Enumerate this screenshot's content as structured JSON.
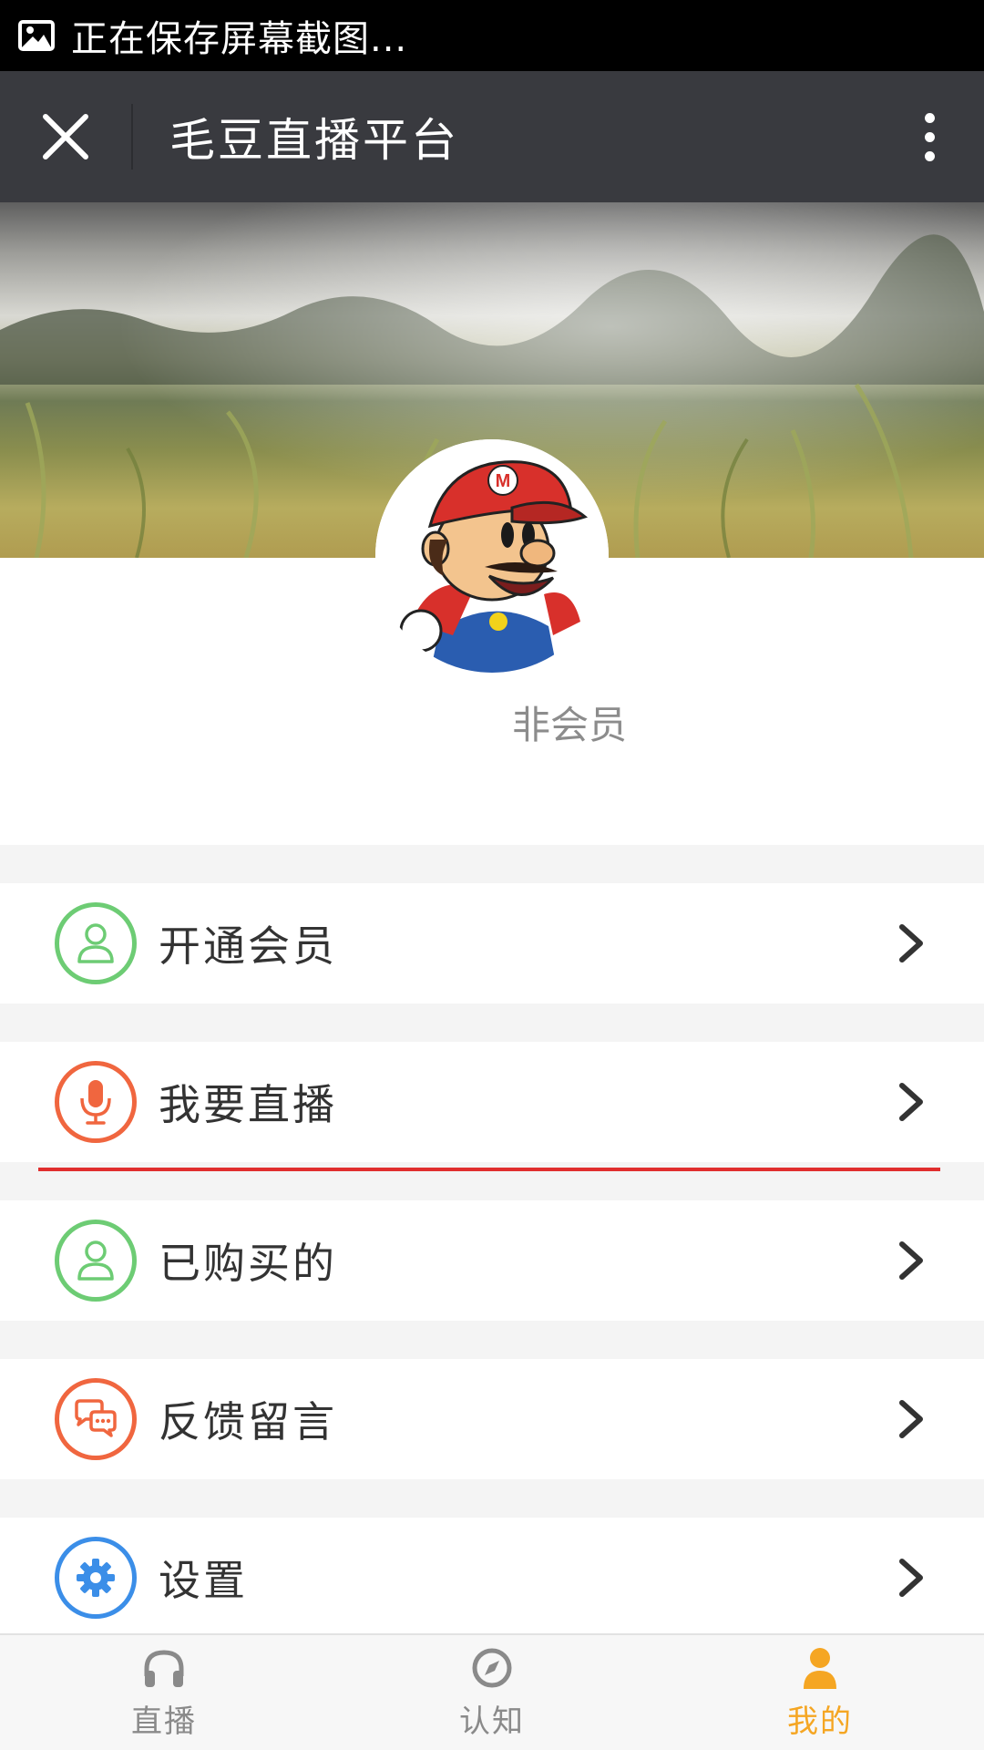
{
  "status_bar": {
    "text": "正在保存屏幕截图..."
  },
  "app_bar": {
    "title": "毛豆直播平台"
  },
  "profile": {
    "membership_status": "非会员"
  },
  "menu": [
    {
      "label": "开通会员",
      "icon": "user-icon",
      "color": "#6dcc74"
    },
    {
      "label": "我要直播",
      "icon": "microphone-icon",
      "color": "#f0663f"
    },
    {
      "label": "已购买的",
      "icon": "user-icon",
      "color": "#6dcc74"
    },
    {
      "label": "反馈留言",
      "icon": "chat-bubbles-icon",
      "color": "#f0663f"
    },
    {
      "label": "设置",
      "icon": "gear-icon",
      "color": "#3b8ee8"
    }
  ],
  "tabs": [
    {
      "label": "直播",
      "icon": "headphones-icon",
      "active": false
    },
    {
      "label": "认知",
      "icon": "compass-icon",
      "active": false
    },
    {
      "label": "我的",
      "icon": "person-icon",
      "active": true
    }
  ],
  "colors": {
    "accent": "#f5a623",
    "app_bar": "#393a3f",
    "highlight_line": "#e02e2e"
  }
}
